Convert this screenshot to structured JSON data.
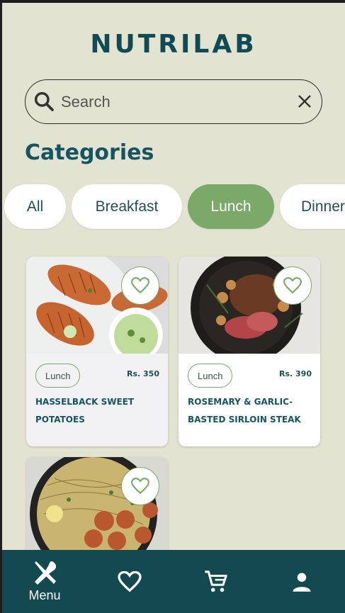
{
  "app": {
    "title": "NUTRILAB"
  },
  "search": {
    "placeholder": "Search",
    "value": ""
  },
  "categories": {
    "title": "Categories",
    "items": [
      {
        "label": "All",
        "active": false
      },
      {
        "label": "Breakfast",
        "active": false
      },
      {
        "label": "Lunch",
        "active": true
      },
      {
        "label": "Dinner",
        "active": false
      }
    ]
  },
  "foods": [
    {
      "name": "HASSELBACK SWEET POTATOES",
      "tag": "Lunch",
      "price": "Rs. 350",
      "favorite": false
    },
    {
      "name": "ROSEMARY & GARLIC-BASTED SIRLOIN STEAK",
      "tag": "Lunch",
      "price": "Rs. 390",
      "favorite": false
    },
    {
      "name": "",
      "tag": "",
      "price": "",
      "favorite": false
    }
  ],
  "nav": {
    "items": [
      {
        "label": "Menu",
        "icon": "fork-knife-icon",
        "active": true
      },
      {
        "label": "",
        "icon": "heart-icon",
        "active": false
      },
      {
        "label": "",
        "icon": "cart-icon",
        "active": false
      },
      {
        "label": "",
        "icon": "person-icon",
        "active": false
      }
    ]
  },
  "colors": {
    "background": "#e3e3d2",
    "primary": "#134a52",
    "accent": "#7aa96a",
    "card": "#f2f2f4"
  }
}
